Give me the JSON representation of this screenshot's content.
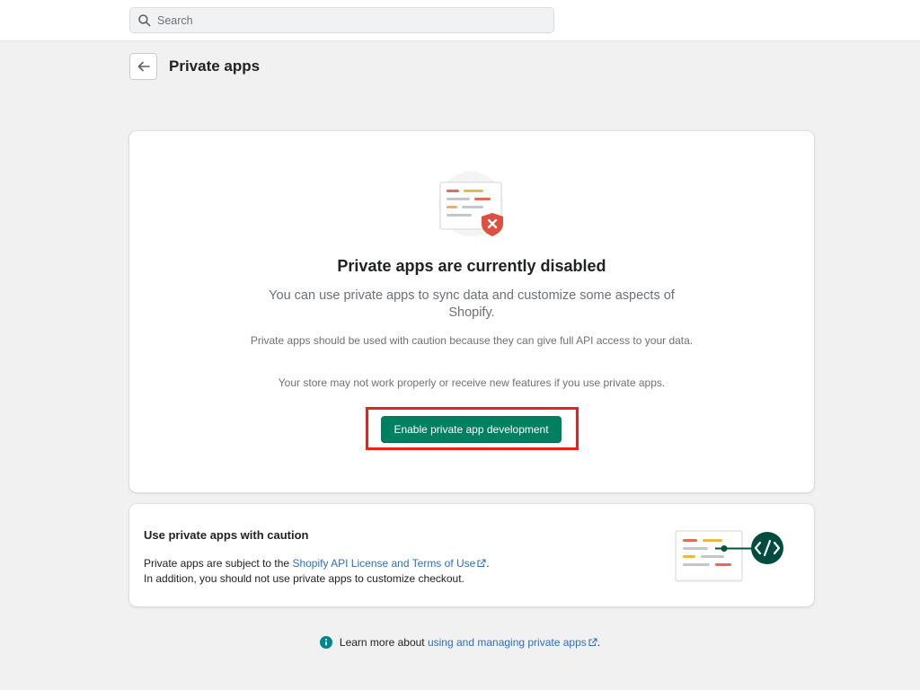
{
  "search": {
    "placeholder": "Search"
  },
  "header": {
    "title": "Private apps"
  },
  "empty_state": {
    "heading": "Private apps are currently disabled",
    "description": "You can use private apps to sync data and customize some aspects of Shopify.",
    "caution": "Private apps should be used with caution because they can give full API access to your data.",
    "warning": "Your store may not work properly or receive new features if you use private apps.",
    "button_label": "Enable private app development"
  },
  "caution_card": {
    "title": "Use private apps with caution",
    "line1_prefix": "Private apps are subject to the ",
    "line1_link": "Shopify API License and Terms of Use",
    "line1_suffix": ".",
    "line2": "In addition, you should not use private apps to customize checkout."
  },
  "footer": {
    "prefix": "Learn more about ",
    "link": "using and managing private apps",
    "suffix": "."
  },
  "icons": {
    "search": "search-icon",
    "back": "arrow-left-icon",
    "external": "external-link-icon",
    "info": "info-icon"
  },
  "colors": {
    "primary_button": "#008060",
    "highlight_border": "#e8231c",
    "link": "#2c6ecb",
    "info": "#00848e",
    "page_background": "#f1f1f1"
  }
}
